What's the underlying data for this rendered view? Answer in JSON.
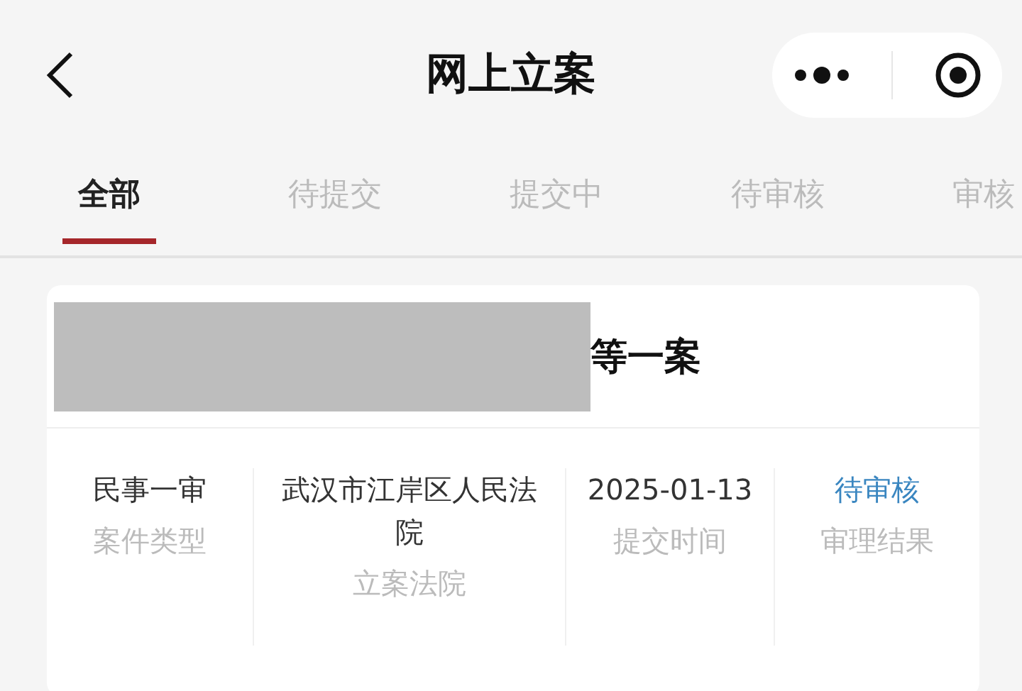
{
  "header": {
    "title": "网上立案"
  },
  "tabs": [
    {
      "label": "全部",
      "selected": true
    },
    {
      "label": "待提交",
      "selected": false
    },
    {
      "label": "提交中",
      "selected": false
    },
    {
      "label": "待审核",
      "selected": false
    },
    {
      "label": "审核",
      "selected": false
    }
  ],
  "case_card": {
    "redacted": true,
    "title": "等一案",
    "fields": [
      {
        "kind": "text",
        "value": "民事一审",
        "label": "案件类型"
      },
      {
        "kind": "text",
        "value": "武汉市江岸区人民法院",
        "label": "立案法院"
      },
      {
        "kind": "text",
        "value": "2025-01-13",
        "label": "提交时间"
      },
      {
        "kind": "status",
        "value": "待审核",
        "label": "审理结果"
      }
    ]
  }
}
